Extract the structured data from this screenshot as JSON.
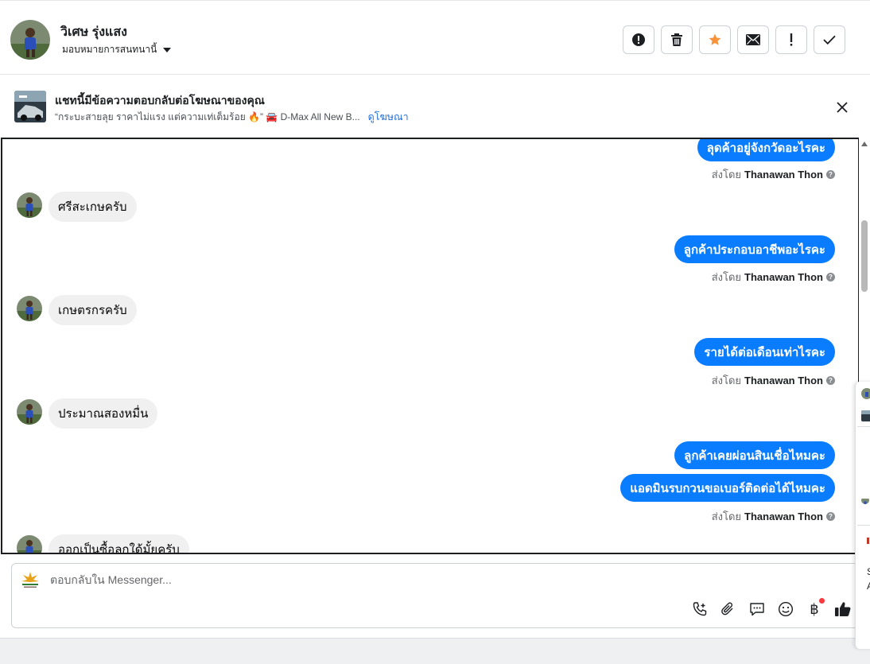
{
  "header": {
    "contact_name": "วิเศษ รุ่งแสง",
    "assign_label": "มอบหมายการสนทนานี้"
  },
  "ad": {
    "title": "แชทนี้มีข้อความตอบกลับต่อโฆษณาของคุณ",
    "quote": "“กระบะสายลุย ราคาไม่แรง แต่ความเท่เต็มร้อย 🔥” 🚘 D-Max All New B...",
    "link": "ดูโฆษณา"
  },
  "messages": {
    "m1": "ลุดค้าอยู่จังกวัดอะไรคะ",
    "m2": "ศรีสะเกษครับ",
    "m3": "ลูกค้าประกอบอาชีพอะไรคะ",
    "m4": "เกษตรกรครับ",
    "m5": "รายได้ต่อเดือนเท่าไรคะ",
    "m6": "ประมาณสองหมื่น",
    "m7": "ลูกค้าเคยผ่อนสินเชื่อไหมคะ",
    "m8": "แอดมินรบกวนขอเบอร์ติดต่อได้ไหมคะ",
    "m9": "ออกเป็นซื้อลกใด้มั้ยครับ"
  },
  "sent_by": {
    "prefix": "ส่งโดย",
    "agent": "Thanawan Thon"
  },
  "reply": {
    "placeholder": "ตอบกลับใน Messenger..."
  },
  "icons": {
    "actions": [
      "alert-circle-icon",
      "trash-icon",
      "star-icon",
      "envelope-icon",
      "exclamation-icon",
      "check-icon"
    ],
    "tools": [
      "phone-add-icon",
      "paperclip-icon",
      "chat-bubble-icon",
      "smile-icon",
      "baht-icon",
      "thumbs-up-icon"
    ],
    "star_color": "#f7923b",
    "bubble_color": "#0a7cff"
  },
  "tools": {
    "baht_symbol": "฿"
  },
  "side_panel": {
    "line1": "S",
    "line2": "A"
  }
}
